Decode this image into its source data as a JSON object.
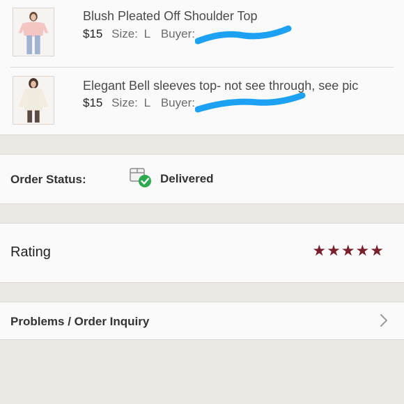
{
  "order_items": [
    {
      "title": "Blush Pleated Off Shoulder Top",
      "price": "$15",
      "size_label": "Size:",
      "size_value": "L",
      "buyer_label": "Buyer:"
    },
    {
      "title": "Elegant Bell sleeves top- not see through, see pic",
      "price": "$15",
      "size_label": "Size:",
      "size_value": "L",
      "buyer_label": "Buyer:"
    }
  ],
  "order_status": {
    "label": "Order Status:",
    "value": "Delivered",
    "icon": "box-delivered-check-icon"
  },
  "rating": {
    "label": "Rating",
    "stars": "★★★★★",
    "value": 5,
    "max": 5
  },
  "problems": {
    "label": "Problems / Order Inquiry",
    "icon": "chevron-right-icon"
  },
  "colors": {
    "star": "#7a1f2c",
    "check": "#2daa4f",
    "redaction": "#1da1f2",
    "background": "#ece9e4",
    "panel": "#fbfafa"
  }
}
